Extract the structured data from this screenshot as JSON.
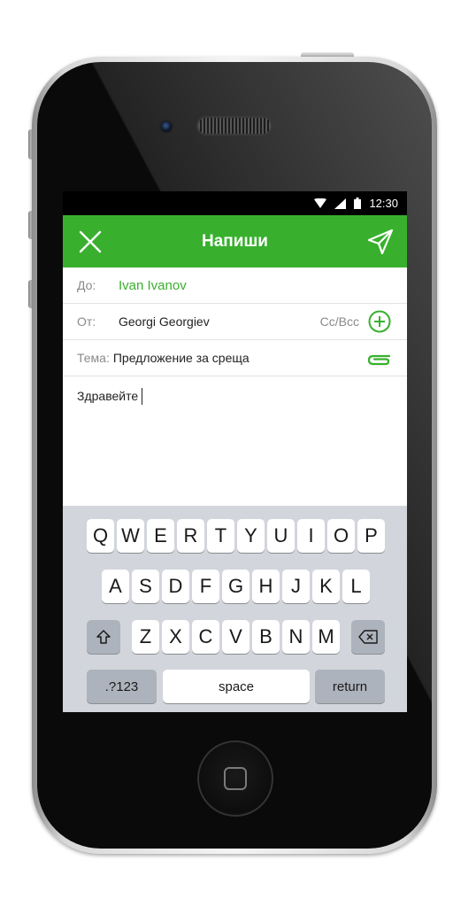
{
  "status_bar": {
    "time": "12:30",
    "icons": [
      "wifi-icon",
      "signal-icon",
      "battery-icon"
    ]
  },
  "header": {
    "title": "Напиши",
    "close_icon": "close-icon",
    "send_icon": "send-icon"
  },
  "compose": {
    "to_label": "До:",
    "to_value": "Ivan Ivanov",
    "from_label": "От:",
    "from_value": "Georgi Georgiev",
    "cc_bcc": "Cc/Bcc",
    "subject_label": "Тема:",
    "subject_value": "Предложение за среща",
    "body": "Здравейте"
  },
  "keyboard": {
    "row1": [
      "Q",
      "W",
      "E",
      "R",
      "T",
      "Y",
      "U",
      "I",
      "O",
      "P"
    ],
    "row2": [
      "A",
      "S",
      "D",
      "F",
      "G",
      "H",
      "J",
      "K",
      "L"
    ],
    "row3": [
      "Z",
      "X",
      "C",
      "V",
      "B",
      "N",
      "M"
    ],
    "numbers": ".?123",
    "space": "space",
    "return": "return"
  },
  "colors": {
    "accent": "#38b02e",
    "keyboard_bg": "#d2d5db",
    "key_bg": "#ffffff",
    "key_dark": "#adb3bc"
  }
}
